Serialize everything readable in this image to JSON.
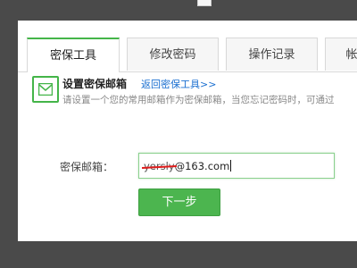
{
  "tabs": [
    {
      "label": "密保工具",
      "active": true
    },
    {
      "label": "修改密码",
      "active": false
    },
    {
      "label": "操作记录",
      "active": false
    },
    {
      "label": "帐",
      "active": false
    }
  ],
  "section": {
    "icon": "mail-icon",
    "title": "设置密保邮箱",
    "back_link": "返回密保工具>>",
    "description": "请设置一个您的常用邮箱作为密保邮箱，当您忘记密码时，可通过"
  },
  "form": {
    "email_label": "密保邮箱：",
    "email_user": "yersly",
    "email_domain": "@163.com",
    "next_button": "下一步"
  },
  "colors": {
    "accent": "#44b549",
    "link": "#1a6fd0",
    "backdrop": "#4a4a4a"
  }
}
